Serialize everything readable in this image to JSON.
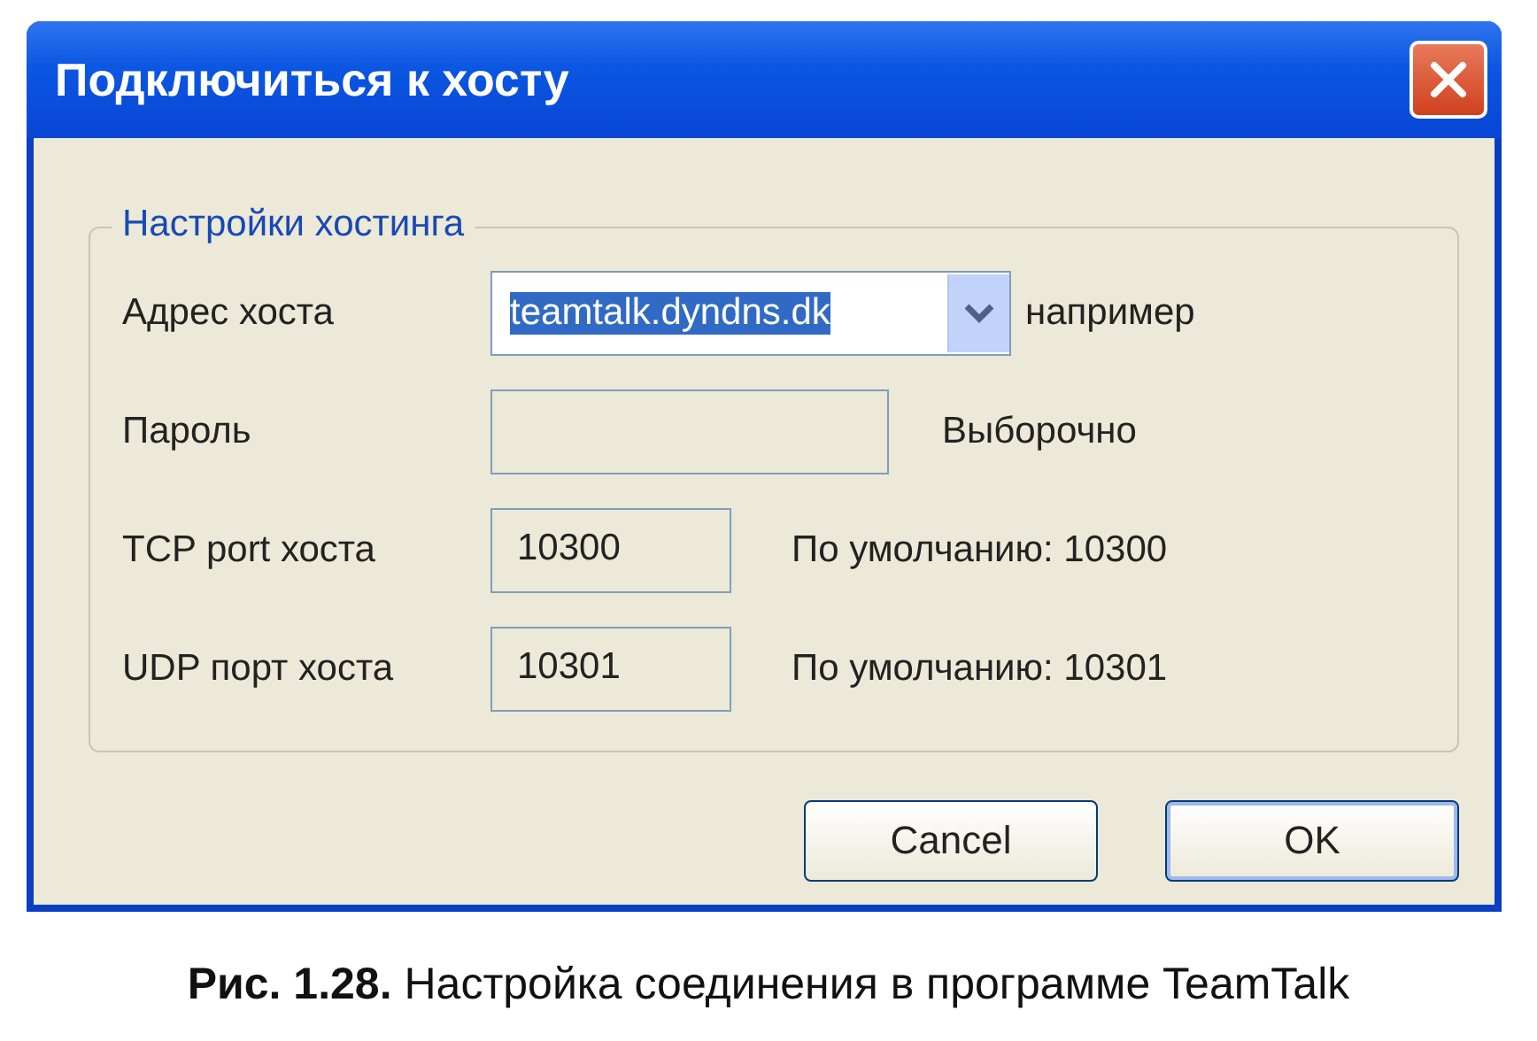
{
  "window": {
    "title": "Подключиться к хосту"
  },
  "group": {
    "title": "Настройки хостинга"
  },
  "fields": [
    {
      "label": "Адрес хоста",
      "kind": "combo",
      "value": "teamtalk.dyndns.dk",
      "selected": true,
      "hint": "например"
    },
    {
      "label": "Пароль",
      "kind": "password",
      "hint": "Выборочно"
    },
    {
      "label": "TCP port хоста",
      "kind": "port",
      "value": "10300",
      "selected": false,
      "hint": "По умолчанию: 10300"
    },
    {
      "label": "UDP порт хоста",
      "kind": "port",
      "value": "10301",
      "selected": false,
      "hint": "По умолчанию: 10301"
    }
  ],
  "buttons": [
    {
      "label": "Cancel",
      "default": false
    },
    {
      "label": "OK",
      "default": true
    }
  ],
  "caption": "**Рис. 1.28.** Настройка соединения в программе TeamTalk"
}
